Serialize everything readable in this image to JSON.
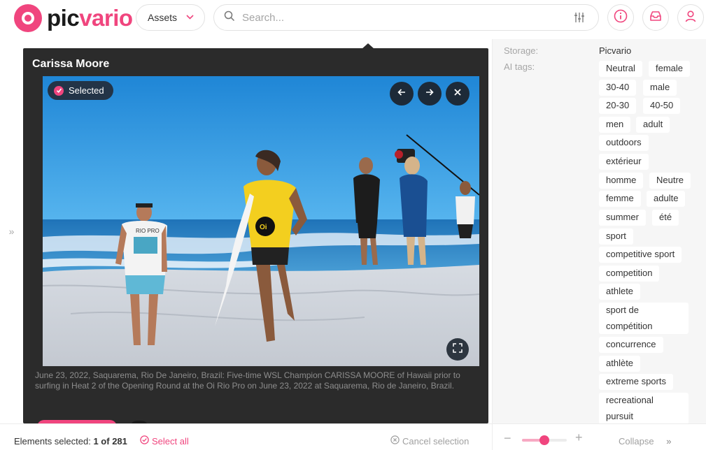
{
  "brand": {
    "logo_a": "pic",
    "logo_b": "vario",
    "color": "#f0457e"
  },
  "header": {
    "assets_label": "Assets",
    "search_placeholder": "Search...",
    "icons": [
      "filter-icon",
      "info-icon",
      "inbox-icon",
      "user-icon"
    ]
  },
  "preview": {
    "title": "Carissa Moore",
    "selected_label": "Selected",
    "caption": "June 23, 2022, Saquarema, Rio De Janeiro, Brazil: Five-time WSL Champion CARISSA MOORE of Hawaii prior to surfing in Heat 2 of the Opening Round at the Oi Rio Pro on June 23, 2022 at Saquarema, Rio de Janeiro, Brazil.",
    "photo_texts": {
      "shirt_brand": "RIO PRO",
      "jersey_number": "Oi"
    }
  },
  "details": {
    "storage_label": "Storage:",
    "storage_value": "Picvario",
    "ai_tags_label": "AI tags:",
    "tags": [
      "Neutral",
      "female",
      "30-40",
      "male",
      "20-30",
      "40-50",
      "men",
      "adult",
      "outdoors",
      "extérieur",
      "homme",
      "Neutre",
      "femme",
      "adulte",
      "summer",
      "été",
      "sport",
      "competitive sport",
      "competition",
      "athlete",
      "sport de compétition",
      "concurrence",
      "athlète",
      "extreme sports",
      "recreational pursuit"
    ]
  },
  "footer": {
    "elements_prefix": "Elements selected:",
    "elements_count": "1 of 281",
    "select_all": "Select all",
    "cancel_selection": "Cancel selection",
    "zoom_minus": "−",
    "zoom_plus": "+",
    "zoom_level": 0.5,
    "collapse": "Collapse",
    "collapse_arrow": "»"
  },
  "side_toggle": "»"
}
